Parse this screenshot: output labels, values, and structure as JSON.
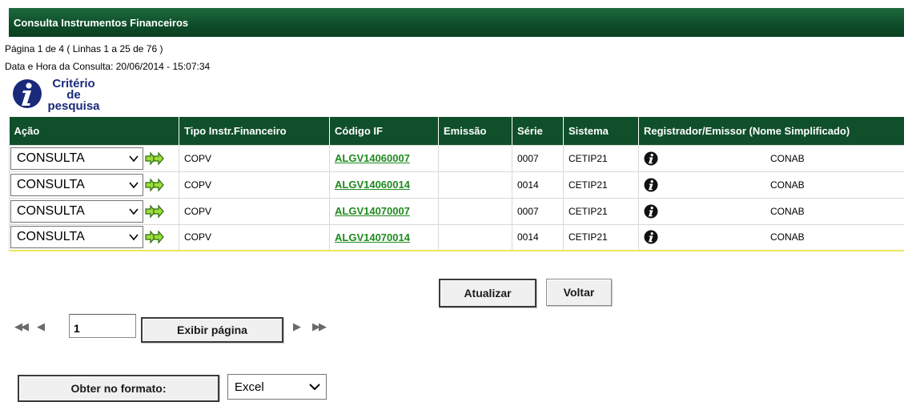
{
  "title": "Consulta Instrumentos Financeiros",
  "pagination_info": "Página 1 de 4 ( Linhas 1 a 25 de 76 )",
  "query_datetime": "Data e Hora da Consulta: 20/06/2014 - 15:07:34",
  "criteria": {
    "line1": "Critério de",
    "line2": "pesquisa",
    "icon": "info-icon"
  },
  "table": {
    "headers": [
      "Ação",
      "Tipo Instr.Financeiro",
      "Código IF",
      "Emissão",
      "Série",
      "Sistema",
      "Registrador/Emissor (Nome Simplificado)"
    ],
    "rows": [
      {
        "acao": "CONSULTA",
        "tipo": "COPV",
        "codigo": "ALGV14060007",
        "emissao": "",
        "serie": "0007",
        "sistema": "CETIP21",
        "registrador": "CONAB"
      },
      {
        "acao": "CONSULTA",
        "tipo": "COPV",
        "codigo": "ALGV14060014",
        "emissao": "",
        "serie": "0014",
        "sistema": "CETIP21",
        "registrador": "CONAB"
      },
      {
        "acao": "CONSULTA",
        "tipo": "COPV",
        "codigo": "ALGV14070007",
        "emissao": "",
        "serie": "0007",
        "sistema": "CETIP21",
        "registrador": "CONAB"
      },
      {
        "acao": "CONSULTA",
        "tipo": "COPV",
        "codigo": "ALGV14070014",
        "emissao": "",
        "serie": "0014",
        "sistema": "CETIP21",
        "registrador": "CONAB"
      }
    ]
  },
  "buttons": {
    "atualizar": "Atualizar",
    "voltar": "Voltar",
    "exibir_pagina": "Exibir página",
    "obter_formato": "Obter no formato:"
  },
  "pager": {
    "first": "◀◀",
    "prev": "◀",
    "next": "▶",
    "last": "▶▶",
    "page_value": "1"
  },
  "format_select": {
    "selected": "Excel"
  },
  "colors": {
    "header_green": "#0f4f2a",
    "link_green": "#1f8a1f",
    "criteria_blue": "#1a2a7a"
  }
}
